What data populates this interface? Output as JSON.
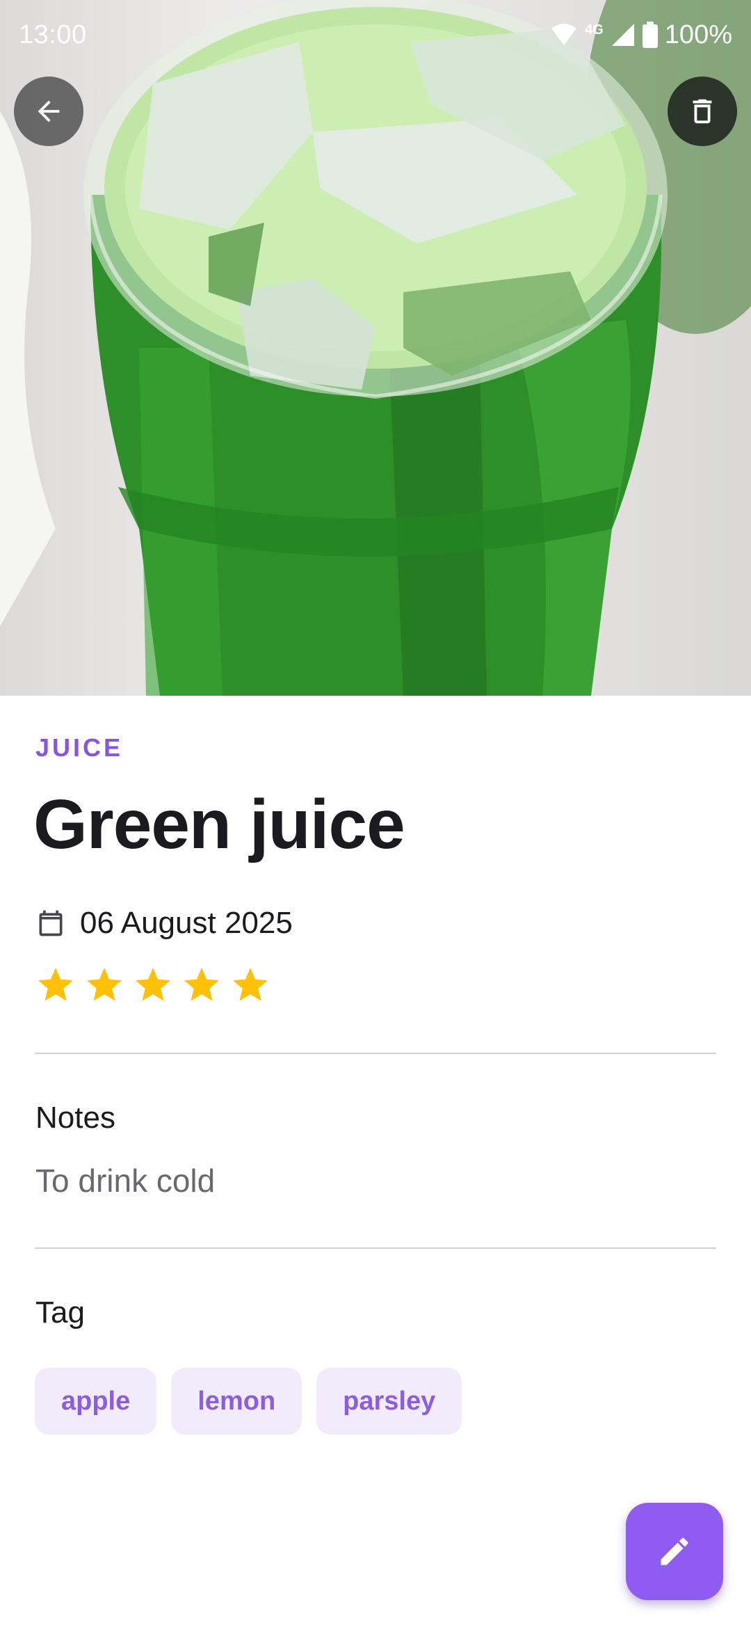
{
  "status_bar": {
    "time": "13:00",
    "network_label": "4G",
    "battery": "100%"
  },
  "hero": {
    "image_icon": "green-juice-photo"
  },
  "drink": {
    "category": "JUICE",
    "name": "Green juice",
    "date": "06 August 2025",
    "rating": 5,
    "rating_max": 5
  },
  "notes": {
    "label": "Notes",
    "text": "To drink cold"
  },
  "tags": {
    "label": "Tag",
    "items": [
      "apple",
      "lemon",
      "parsley"
    ]
  },
  "colors": {
    "accent": "#8756e0",
    "chip_bg": "#f1ebfb",
    "fab": "#8f5cf2",
    "star": "#ffc107"
  },
  "icons": {
    "back": "arrow-left-icon",
    "delete": "trash-icon",
    "date": "calendar-icon",
    "edit": "pencil-icon"
  }
}
